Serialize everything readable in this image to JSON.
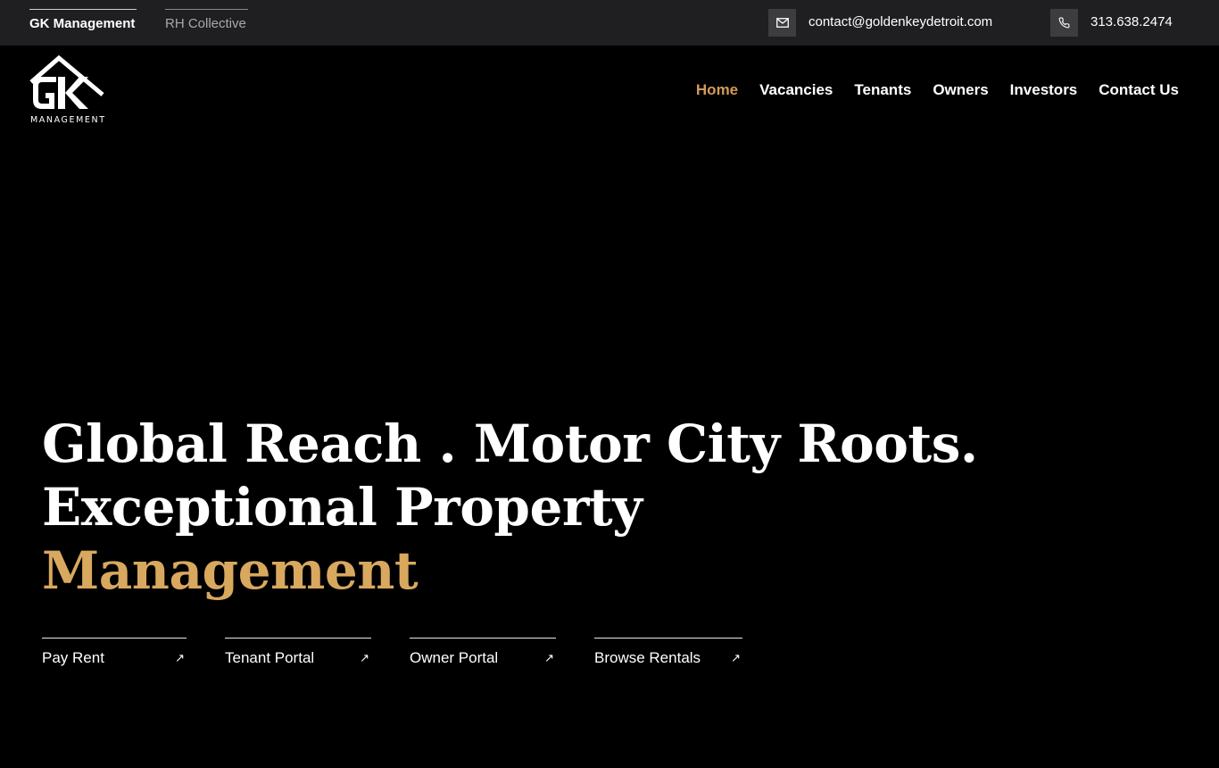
{
  "topbar": {
    "brands": [
      {
        "label": "GK Management",
        "active": true
      },
      {
        "label": "RH Collective",
        "active": false
      }
    ],
    "email": "contact@goldenkeydetroit.com",
    "phone": "313.638.2474",
    "email_icon": "mail-icon",
    "phone_icon": "phone-icon"
  },
  "header": {
    "logo_sub": "MANAGEMENT",
    "nav": [
      {
        "label": "Home",
        "current": true
      },
      {
        "label": "Vacancies"
      },
      {
        "label": "Tenants"
      },
      {
        "label": "Owners"
      },
      {
        "label": "Investors"
      },
      {
        "label": "Contact Us"
      }
    ]
  },
  "hero": {
    "line1": "Global Reach . Motor City Roots.",
    "line2": "Exceptional Property",
    "line3": "Management"
  },
  "cta": [
    {
      "label": "Pay Rent",
      "icon": "arrow-up-right-icon"
    },
    {
      "label": "Tenant Portal",
      "icon": "arrow-up-right-icon"
    },
    {
      "label": "Owner Portal",
      "icon": "arrow-up-right-icon"
    },
    {
      "label": "Browse Rentals",
      "icon": "arrow-up-right-icon"
    }
  ],
  "colors": {
    "accent": "#d39a55",
    "hero_accent": "#d9a85f",
    "topbar_bg": "#1f1f21",
    "background": "#000000"
  }
}
